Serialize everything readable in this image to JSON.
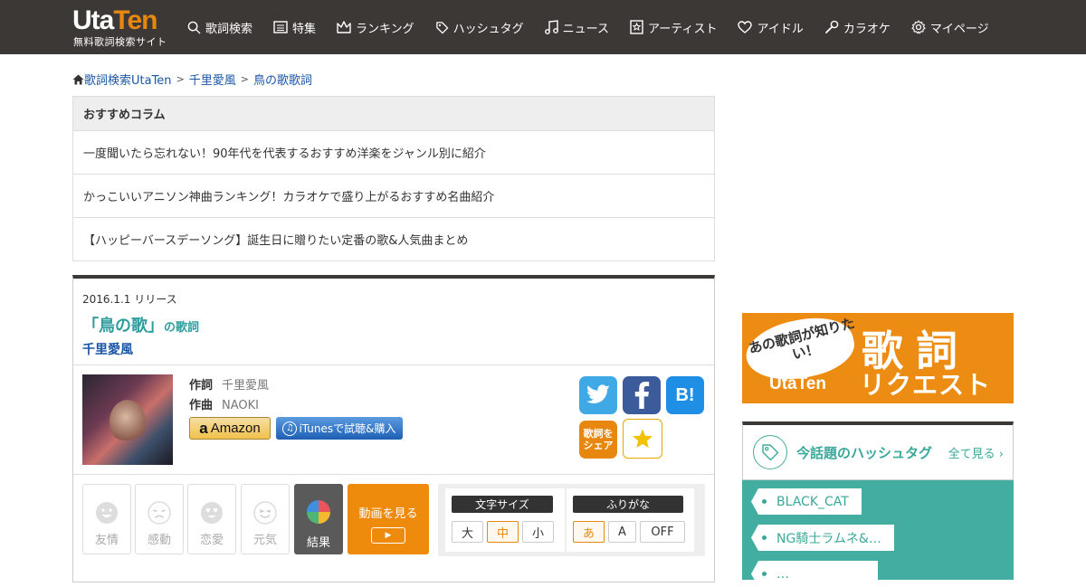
{
  "header": {
    "logo_main": "Uta",
    "logo_main_accent": "Ten",
    "logo_sub": "無料歌詞検索サイト",
    "nav": [
      {
        "icon": "search-icon",
        "label": "歌詞検索"
      },
      {
        "icon": "newspaper-icon",
        "label": "特集"
      },
      {
        "icon": "crown-icon",
        "label": "ランキング"
      },
      {
        "icon": "tag-icon",
        "label": "ハッシュタグ"
      },
      {
        "icon": "music-note-icon",
        "label": "ニュース"
      },
      {
        "icon": "artist-card-icon",
        "label": "アーティスト"
      },
      {
        "icon": "heart-icon",
        "label": "アイドル"
      },
      {
        "icon": "microphone-icon",
        "label": "カラオケ"
      },
      {
        "icon": "gear-icon",
        "label": "マイページ"
      }
    ]
  },
  "breadcrumb": {
    "home": "歌詞検索UtaTen",
    "artist": "千里愛風",
    "current": "鳥の歌歌詞",
    "sep": ">"
  },
  "columns": {
    "title": "おすすめコラム",
    "items": [
      "一度聞いたら忘れない！90年代を代表するおすすめ洋楽をジャンル別に紹介",
      "かっこいいアニソン神曲ランキング！カラオケで盛り上がるおすすめ名曲紹介",
      "【ハッピーバースデーソング】誕生日に贈りたい定番の歌&人気曲まとめ"
    ]
  },
  "song": {
    "release": "2016.1.1 リリース",
    "title": "「鳥の歌」",
    "title_suffix": "の歌詞",
    "artist": "千里愛風",
    "lyricist_label": "作詞",
    "lyricist": "千里愛風",
    "composer_label": "作曲",
    "composer": "NAOKI",
    "amazon_label": "Amazon",
    "itunes_label": "iTunesで試聴&購入",
    "share_label_1": "歌詞を",
    "share_label_2": "シェア",
    "hatena_label": "B!"
  },
  "emotions": [
    {
      "icon": "smile-face-icon",
      "label": "友情"
    },
    {
      "icon": "moved-face-icon",
      "label": "感動"
    },
    {
      "icon": "love-face-icon",
      "label": "恋愛"
    },
    {
      "icon": "cheerful-face-icon",
      "label": "元気"
    }
  ],
  "result_label": "結果",
  "video": {
    "label": "動画を見る"
  },
  "font_size": {
    "label": "文字サイズ",
    "options": [
      "大",
      "中",
      "小"
    ],
    "selected": "中"
  },
  "furigana": {
    "label": "ふりがな",
    "options": [
      "あ",
      "A",
      "OFF"
    ],
    "selected": "あ"
  },
  "banner": {
    "bubble": "あの歌詞が知りたい！",
    "logo": "UtaTen",
    "big": "歌詞",
    "sub": "リクエスト"
  },
  "hashtags": {
    "title": "今話題のハッシュタグ",
    "see_all": "全て見る",
    "items": [
      "BLACK_CAT",
      "NG騎士ラムネ&…",
      "…"
    ]
  },
  "colors": {
    "header_bg": "#3b3835",
    "accent_orange": "#e8870e",
    "teal": "#42ada0",
    "link_blue": "#1a55a6"
  }
}
